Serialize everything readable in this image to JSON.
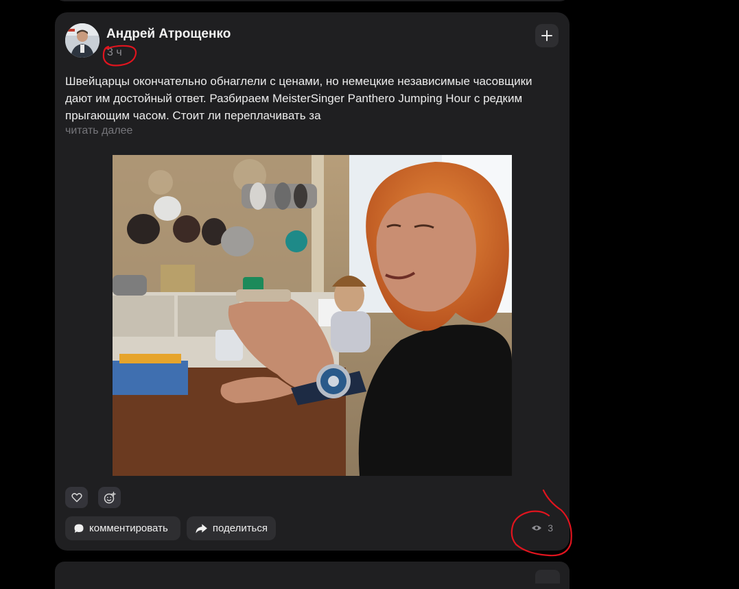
{
  "post": {
    "author": "Андрей Атрощенко",
    "time": "3 ч",
    "text": "Швейцарцы окончательно обнаглели с ценами, но немецкие независимые часовщики дают им достойный ответ. Разбираем MeisterSinger Panthero Jumping Hour с редким прыгающим часом. Стоит ли переплачивать за",
    "read_more": "читать далее",
    "comment_label": "комментировать",
    "share_label": "поделиться",
    "views": "3"
  },
  "icons": {
    "add": "plus-icon",
    "like": "heart-icon",
    "reaction": "add-reaction-icon",
    "comment": "speech-bubble-icon",
    "share": "share-arrow-icon",
    "views": "eye-icon"
  },
  "colors": {
    "background": "#000000",
    "card": "#1f1f21",
    "button": "#2e2e31",
    "annotation": "#e0141e"
  }
}
